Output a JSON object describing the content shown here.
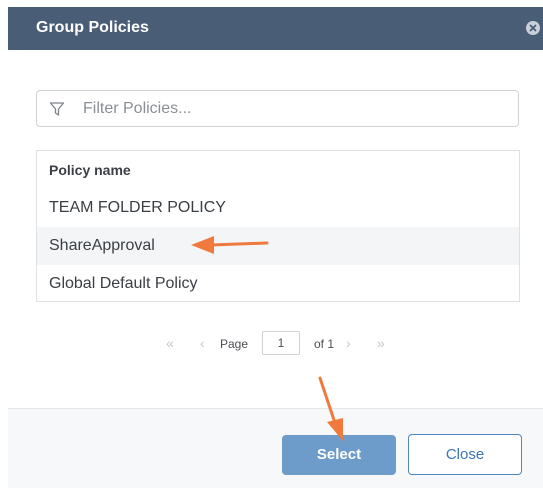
{
  "dialog": {
    "title": "Group Policies",
    "close_icon": "close-circle-icon"
  },
  "filter": {
    "placeholder": "Filter Policies...",
    "value": "",
    "icon": "filter-icon"
  },
  "table": {
    "column_header": "Policy name",
    "rows": [
      "TEAM FOLDER POLICY",
      "ShareApproval",
      "Global Default Policy"
    ],
    "highlighted_row": "ShareApproval"
  },
  "pager": {
    "first_icon": "«",
    "prev_icon": "‹",
    "page_label": "Page",
    "current_page": "1",
    "of_label": "of 1",
    "next_icon": "›",
    "last_icon": "»"
  },
  "footer": {
    "select_label": "Select",
    "close_label": "Close"
  },
  "colors": {
    "header_bg": "#4a5d76",
    "select_button": "#6d9ccb",
    "close_button_border": "#4f86c2",
    "annotation_arrow": "#f07a3d"
  }
}
